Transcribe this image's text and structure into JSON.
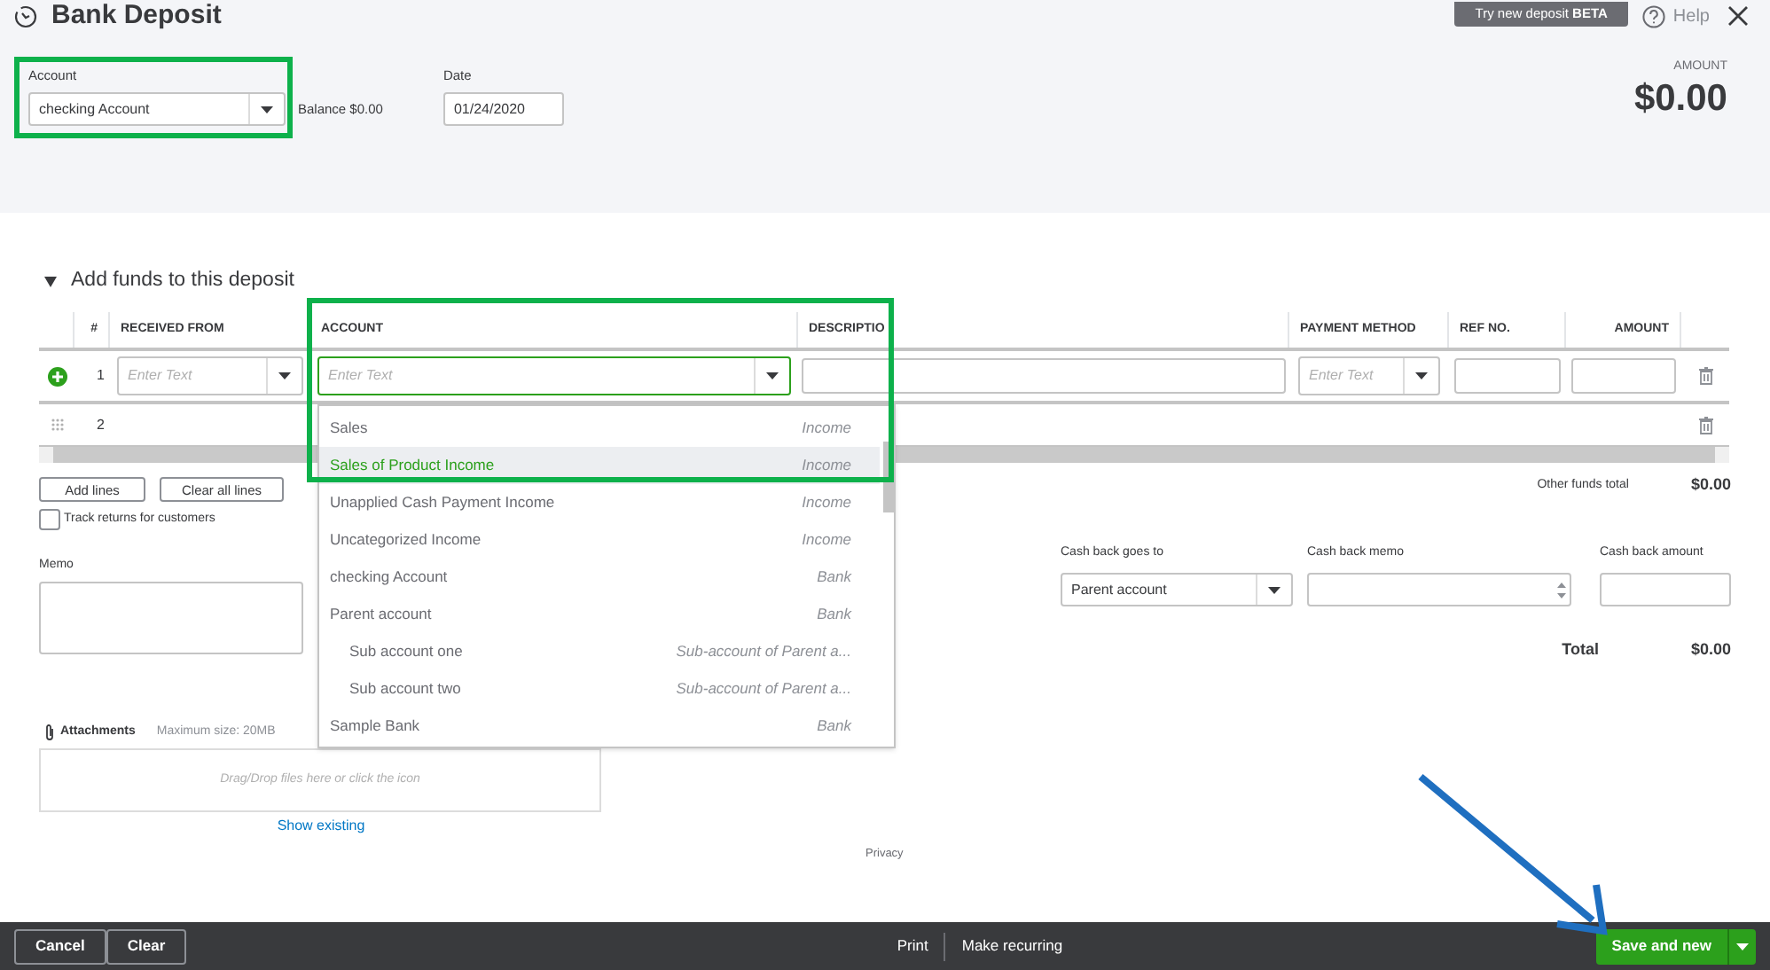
{
  "header": {
    "title": "Bank Deposit",
    "beta_button": "Try new deposit **BETA**",
    "help": "Help"
  },
  "account": {
    "label": "Account",
    "value": "checking Account"
  },
  "balance": "Balance $0.00",
  "date": {
    "label": "Date",
    "value": "01/24/2020"
  },
  "amount": {
    "label": "AMOUNT",
    "value": "$0.00"
  },
  "section": {
    "title": "Add funds to this deposit",
    "expanded": true
  },
  "table": {
    "columns": [
      "#",
      "RECEIVED FROM",
      "ACCOUNT",
      "DESCRIPTIO",
      "PAYMENT METHOD",
      "REF NO.",
      "AMOUNT"
    ],
    "rows": [
      {
        "number": "1",
        "active": true,
        "received_from": {
          "placeholder": "Enter Text"
        },
        "account": {
          "placeholder": "Enter Text"
        },
        "payment_method": {
          "placeholder": "Enter Text"
        }
      },
      {
        "number": "2",
        "active": false
      }
    ]
  },
  "account_dropdown": {
    "items": [
      {
        "name": "Sales",
        "type": "Income",
        "selected": false
      },
      {
        "name": "Sales of Product Income",
        "type": "Income",
        "selected": true
      },
      {
        "name": "Unapplied Cash Payment Income",
        "type": "Income",
        "selected": false
      },
      {
        "name": "Uncategorized Income",
        "type": "Income",
        "selected": false
      },
      {
        "name": "checking Account",
        "type": "Bank",
        "selected": false
      },
      {
        "name": "Parent account",
        "type": "Bank",
        "selected": false,
        "children": [
          {
            "name": "Sub account one",
            "type": "Sub-account of Parent a...",
            "selected": false
          },
          {
            "name": "Sub account two",
            "type": "Sub-account of Parent a...",
            "selected": false
          }
        ]
      },
      {
        "name": "Sample Bank",
        "type": "Bank",
        "selected": false
      }
    ]
  },
  "line_buttons": [
    "Add lines",
    "Clear all lines"
  ],
  "track_returns": {
    "label": "Track returns for customers",
    "checked": false
  },
  "other_funds": {
    "label": "Other funds total",
    "value": "$0.00"
  },
  "memo": {
    "label": "Memo"
  },
  "cash_back": {
    "goes_to": {
      "label": "Cash back goes to",
      "value": "Parent account"
    },
    "memo": {
      "label": "Cash back memo"
    },
    "amount": {
      "label": "Cash back amount"
    }
  },
  "total": {
    "label": "Total",
    "value": "$0.00"
  },
  "attachments": {
    "label": "Attachments",
    "max_size": "Maximum size: 20MB",
    "drop_hint": "Drag/Drop files here or click the icon",
    "show_existing": "Show existing"
  },
  "privacy": "Privacy",
  "footer": {
    "left_buttons": [
      "Cancel",
      "Clear"
    ],
    "center_buttons": [
      "Print",
      "Make recurring"
    ],
    "save": "Save and new"
  }
}
